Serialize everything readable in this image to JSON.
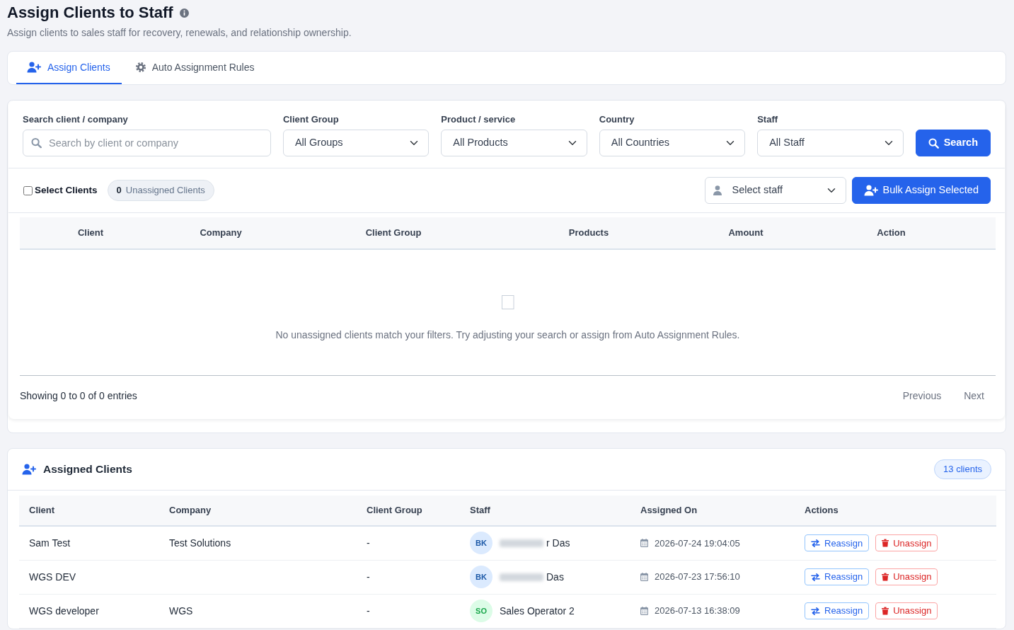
{
  "page": {
    "title": "Assign Clients to Staff",
    "subtitle": "Assign clients to sales staff for recovery, renewals, and relationship ownership."
  },
  "tabs": [
    {
      "kind": "assign",
      "label": "Assign Clients",
      "selected": true
    },
    {
      "kind": "rules",
      "label": "Auto Assignment Rules",
      "selected": false
    }
  ],
  "filters": {
    "search": {
      "label": "Search client / company",
      "placeholder": "Search by client or company"
    },
    "selects": [
      {
        "label": "Client Group",
        "value": "All Groups"
      },
      {
        "label": "Product / service",
        "value": "All Products"
      },
      {
        "label": "Country",
        "value": "All Countries"
      },
      {
        "label": "Staff",
        "value": "All Staff"
      }
    ],
    "search_button": "Search"
  },
  "bulk_bar": {
    "select_all": {
      "label": "Select Clients",
      "checked": false
    },
    "unassigned_count": "0",
    "unassigned_label": "Unassigned Clients",
    "staff_select": "Select staff",
    "bulk_button": "Bulk Assign Selected"
  },
  "unassigned_table": {
    "columns": [
      "Client",
      "Company",
      "Client Group",
      "Products",
      "Amount",
      "Action"
    ],
    "empty_message": "No unassigned clients match your filters. Try adjusting your search or assign from Auto Assignment Rules.",
    "info": "Showing 0 to 0 of 0 entries",
    "pagination": [
      {
        "label": "Previous",
        "disabled": true
      },
      {
        "label": "Next",
        "disabled": true
      }
    ]
  },
  "assigned": {
    "title": "Assigned Clients",
    "count_badge": "13 clients",
    "columns": [
      "Client",
      "Company",
      "Client Group",
      "Staff",
      "Assigned On",
      "Actions"
    ],
    "rows": [
      {
        "client": "Sam Test",
        "company": "Test Solutions",
        "client_group": "-",
        "staff": {
          "initials": "BK",
          "name": "r Das",
          "redacted": true,
          "color": "#dbeafe"
        },
        "assigned_on": "2026-07-24 19:04:05",
        "actions": [
          {
            "kind": "reassign",
            "label": "Reassign"
          },
          {
            "kind": "unassign",
            "label": "Unassign"
          }
        ]
      },
      {
        "client": "WGS DEV",
        "client_group": "-",
        "staff": {
          "initials": "BK",
          "name": "Das",
          "redacted": true,
          "color": "#dbeafe"
        },
        "assigned_on": "2026-07-23 17:56:10",
        "actions": [
          {
            "kind": "reassign",
            "label": "Reassign"
          },
          {
            "kind": "unassign",
            "label": "Unassign"
          }
        ]
      },
      {
        "client": "WGS developer",
        "company": "WGS",
        "client_group": "-",
        "staff": {
          "initials": "SO",
          "name": "Sales Operator 2",
          "redacted": false,
          "color": "#dcfce7"
        },
        "assigned_on": "2026-07-13 16:38:09",
        "actions": [
          {
            "kind": "reassign",
            "label": "Reassign"
          },
          {
            "kind": "unassign",
            "label": "Unassign"
          }
        ]
      }
    ]
  }
}
